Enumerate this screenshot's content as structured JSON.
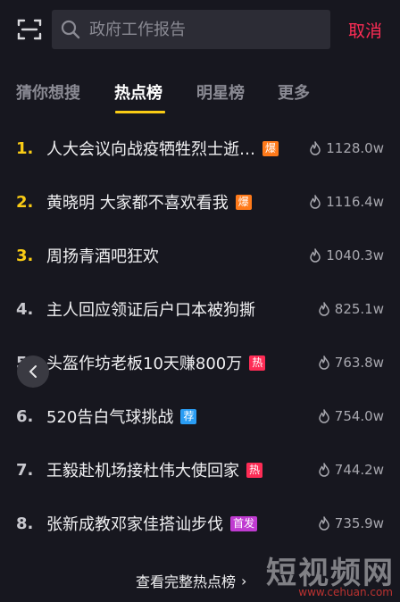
{
  "search": {
    "placeholder": "政府工作报告",
    "cancel_label": "取消"
  },
  "tabs": [
    {
      "label": "猜你想搜",
      "active": false
    },
    {
      "label": "热点榜",
      "active": true
    },
    {
      "label": "明星榜",
      "active": false
    },
    {
      "label": "更多",
      "active": false
    }
  ],
  "hot_list": [
    {
      "rank": "1.",
      "title": "人大会议向战疫牺牲烈士逝…",
      "badge": "爆",
      "badge_color": "#ff7a1a",
      "heat": "1128.0w"
    },
    {
      "rank": "2.",
      "title": "黄晓明 大家都不喜欢看我",
      "badge": "爆",
      "badge_color": "#ff7a1a",
      "heat": "1116.4w"
    },
    {
      "rank": "3.",
      "title": "周扬青酒吧狂欢",
      "badge": "",
      "badge_color": "",
      "heat": "1040.3w"
    },
    {
      "rank": "4.",
      "title": "主人回应领证后户口本被狗撕",
      "badge": "",
      "badge_color": "",
      "heat": "825.1w"
    },
    {
      "rank": "5.",
      "title": "头盔作坊老板10天赚800万",
      "badge": "热",
      "badge_color": "#fe2c55",
      "heat": "763.8w"
    },
    {
      "rank": "6.",
      "title": "520告白气球挑战",
      "badge": "荐",
      "badge_color": "#2a9df4",
      "heat": "754.0w"
    },
    {
      "rank": "7.",
      "title": "王毅赴机场接杜伟大使回家",
      "badge": "热",
      "badge_color": "#fe2c55",
      "heat": "744.2w"
    },
    {
      "rank": "8.",
      "title": "张新成教邓家佳搭讪步伐",
      "badge": "首发",
      "badge_color": "#c03bd1",
      "heat": "735.9w"
    }
  ],
  "footer": {
    "view_full_label": "查看完整热点榜",
    "chevron": "›"
  },
  "watermark": {
    "title": "短视频网",
    "url": "www.cehuan.com"
  },
  "colors": {
    "accent": "#facc15",
    "cancel": "#fe2c55",
    "background": "#17171f"
  }
}
